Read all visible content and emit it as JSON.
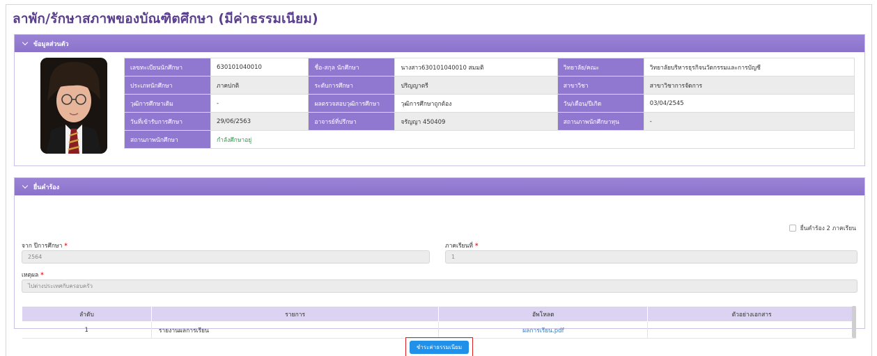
{
  "page": {
    "title": "ลาพัก/รักษาสภาพของบัณฑิตศึกษา (มีค่าธรรมเนียม)"
  },
  "personal": {
    "header": "ข้อมูลส่วนตัว",
    "rows": [
      [
        {
          "label": "เลขทะเบียนนักศึกษา",
          "value": "630101040010"
        },
        {
          "label": "ชื่อ-สกุล นักศึกษา",
          "value": "นางสาว630101040010 สมมติ"
        },
        {
          "label": "วิทยาลัย/คณะ",
          "value": "วิทยาลัยบริหารธุรกิจนวัตกรรมและการบัญชี"
        }
      ],
      [
        {
          "label": "ประเภทนักศึกษา",
          "value": "ภาคปกติ"
        },
        {
          "label": "ระดับการศึกษา",
          "value": "ปริญญาตรี"
        },
        {
          "label": "สาขาวิชา",
          "value": "สาขาวิชาการจัดการ"
        }
      ],
      [
        {
          "label": "วุฒิการศึกษาเดิม",
          "value": "-"
        },
        {
          "label": "ผลตรวจสอบวุฒิการศึกษา",
          "value": "วุฒิการศึกษาถูกต้อง"
        },
        {
          "label": "วัน/เดือน/ปีเกิด",
          "value": "03/04/2545"
        }
      ],
      [
        {
          "label": "วันที่เข้ารับการศึกษา",
          "value": "29/06/2563"
        },
        {
          "label": "อาจารย์ที่ปรึกษา",
          "value": "จรัญญา 450409"
        },
        {
          "label": "สถานภาพนักศึกษาทุน",
          "value": "-"
        }
      ]
    ],
    "status": {
      "label": "สถานภาพนักศึกษา",
      "value": "กำลังศึกษาอยู่"
    }
  },
  "request": {
    "header": "ยื่นคำร้อง",
    "two_terms_label": "ยื่นคำร้อง 2 ภาคเรียน",
    "year_label": "จาก ปีการศึกษา",
    "year_value": "2564",
    "term_label": "ภาคเรียนที่",
    "term_value": "1",
    "reason_label": "เหตุผล",
    "reason_value": "ไปต่างประเทศกับครอบครัว",
    "required_mark": "*",
    "table": {
      "headers": [
        "ลำดับ",
        "รายการ",
        "อัพโหลด",
        "ตัวอย่างเอกสาร"
      ],
      "rows": [
        {
          "no": "1",
          "item": "รายงานผลการเรียน",
          "upload": "ผลการเรียน.pdf",
          "sample": ""
        }
      ]
    }
  },
  "actions": {
    "pay_label": "ชำระค่าธรรมเนียม"
  },
  "colors": {
    "accent": "#9077cf",
    "title": "#5b3f8f",
    "button": "#2190e8",
    "highlight": "#e02020",
    "status": "#2e9e4a"
  }
}
